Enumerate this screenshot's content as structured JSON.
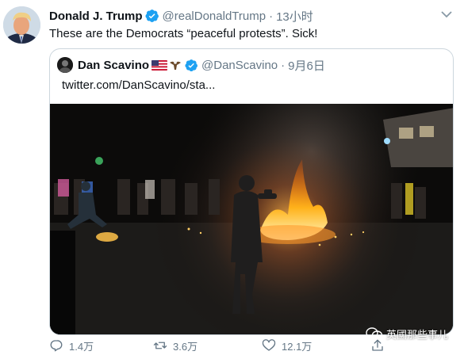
{
  "tweet": {
    "author_name": "Donald J. Trump",
    "author_handle": "@realDonaldTrump",
    "separator": "·",
    "timestamp": "13小时",
    "text": "These are the Democrats “peaceful protests”. Sick!"
  },
  "quoted": {
    "author_name": "Dan Scavino",
    "author_handle": "@DanScavino",
    "separator": "·",
    "timestamp": "9月6日",
    "link": "twitter.com/DanScavino/sta..."
  },
  "actions": {
    "reply_count": "1.4万",
    "retweet_count": "3.6万",
    "like_count": "12.1万"
  },
  "watermark": {
    "text": "英國那些事儿"
  },
  "icons": {
    "verified": "verified-badge-icon",
    "caret": "chevron-down-icon",
    "reply": "reply-icon",
    "retweet": "retweet-icon",
    "like": "heart-icon",
    "share": "share-icon",
    "flag": "us-flag-icon",
    "eagle": "eagle-icon",
    "watermark": "wechat-icon"
  },
  "colors": {
    "verified": "#1da1f2",
    "secondary_text": "#657786",
    "border": "#ccd6dd"
  }
}
